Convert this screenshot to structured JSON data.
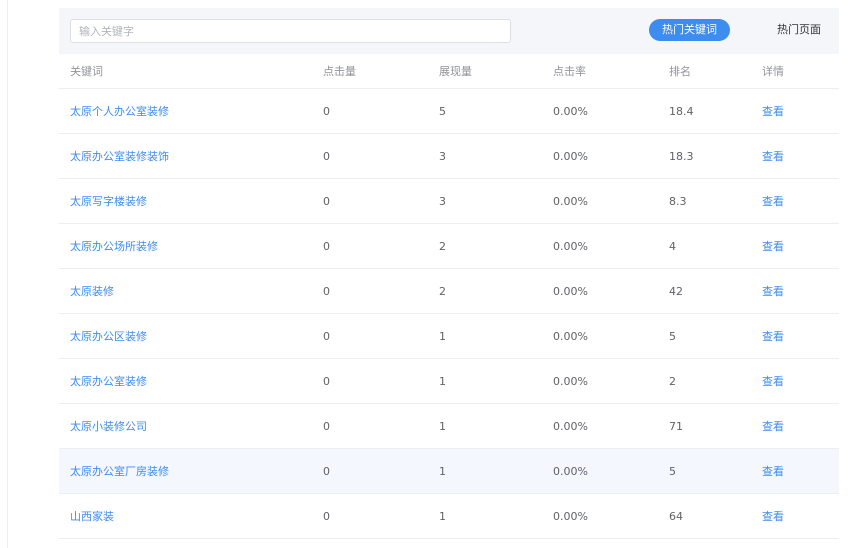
{
  "search": {
    "placeholder": "输入关键字",
    "value": ""
  },
  "tabs": [
    {
      "label": "热门关键词",
      "active": true
    },
    {
      "label": "热门页面",
      "active": false
    }
  ],
  "table": {
    "columns": [
      "关键词",
      "点击量",
      "展现量",
      "点击率",
      "排名",
      "详情"
    ],
    "rows": [
      {
        "keyword": "太原个人办公室装修",
        "clicks": "0",
        "views": "5",
        "rate": "0.00%",
        "rank": "18.4",
        "detail": "查看"
      },
      {
        "keyword": "太原办公室装修装饰",
        "clicks": "0",
        "views": "3",
        "rate": "0.00%",
        "rank": "18.3",
        "detail": "查看"
      },
      {
        "keyword": "太原写字楼装修",
        "clicks": "0",
        "views": "3",
        "rate": "0.00%",
        "rank": "8.3",
        "detail": "查看"
      },
      {
        "keyword": "太原办公场所装修",
        "clicks": "0",
        "views": "2",
        "rate": "0.00%",
        "rank": "4",
        "detail": "查看"
      },
      {
        "keyword": "太原装修",
        "clicks": "0",
        "views": "2",
        "rate": "0.00%",
        "rank": "42",
        "detail": "查看"
      },
      {
        "keyword": "太原办公区装修",
        "clicks": "0",
        "views": "1",
        "rate": "0.00%",
        "rank": "5",
        "detail": "查看"
      },
      {
        "keyword": "太原办公室装修",
        "clicks": "0",
        "views": "1",
        "rate": "0.00%",
        "rank": "2",
        "detail": "查看"
      },
      {
        "keyword": "太原小装修公司",
        "clicks": "0",
        "views": "1",
        "rate": "0.00%",
        "rank": "71",
        "detail": "查看"
      },
      {
        "keyword": "太原办公室厂房装修",
        "clicks": "0",
        "views": "1",
        "rate": "0.00%",
        "rank": "5",
        "detail": "查看",
        "highlighted": true
      },
      {
        "keyword": "山西家装",
        "clicks": "0",
        "views": "1",
        "rate": "0.00%",
        "rank": "64",
        "detail": "查看"
      }
    ]
  },
  "colors": {
    "accent": "#3d8cf0",
    "toolbar_bg": "#f4f6f9",
    "row_highlight": "#f4f7fd"
  }
}
